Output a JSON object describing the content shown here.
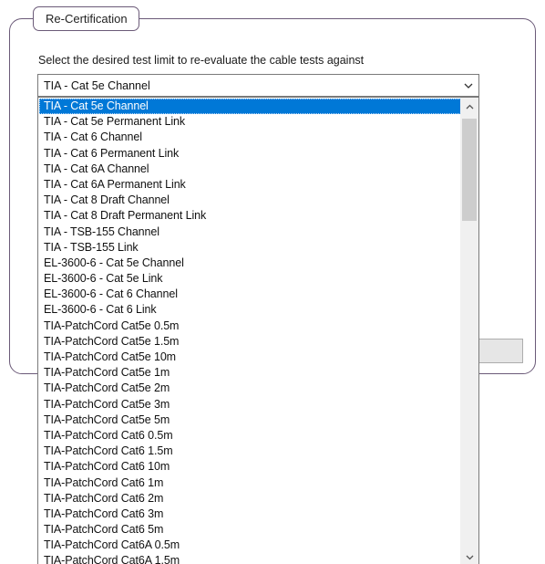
{
  "groupbox": {
    "title": "Re-Certification"
  },
  "instruction": "Select the desired test limit to re-evaluate the cable tests against",
  "combo": {
    "selected_value": "TIA - Cat 5e Channel"
  },
  "dropdown": {
    "scroll_position": 0.0,
    "items": [
      {
        "label": "TIA - Cat 5e Channel",
        "selected": true
      },
      {
        "label": "TIA - Cat 5e Permanent Link"
      },
      {
        "label": "TIA - Cat 6 Channel"
      },
      {
        "label": "TIA - Cat 6 Permanent Link"
      },
      {
        "label": "TIA - Cat 6A Channel"
      },
      {
        "label": "TIA - Cat 6A Permanent Link"
      },
      {
        "label": "TIA - Cat 8 Draft Channel"
      },
      {
        "label": "TIA - Cat 8 Draft Permanent Link"
      },
      {
        "label": "TIA - TSB-155 Channel"
      },
      {
        "label": "TIA - TSB-155 Link"
      },
      {
        "label": "EL-3600-6 - Cat 5e Channel"
      },
      {
        "label": "EL-3600-6 - Cat 5e Link"
      },
      {
        "label": "EL-3600-6 - Cat 6 Channel"
      },
      {
        "label": "EL-3600-6 - Cat 6 Link"
      },
      {
        "label": "TIA-PatchCord Cat5e 0.5m"
      },
      {
        "label": "TIA-PatchCord Cat5e 1.5m"
      },
      {
        "label": "TIA-PatchCord Cat5e 10m"
      },
      {
        "label": "TIA-PatchCord Cat5e 1m"
      },
      {
        "label": "TIA-PatchCord Cat5e 2m"
      },
      {
        "label": "TIA-PatchCord Cat5e 3m"
      },
      {
        "label": "TIA-PatchCord Cat5e 5m"
      },
      {
        "label": "TIA-PatchCord Cat6 0.5m"
      },
      {
        "label": "TIA-PatchCord Cat6 1.5m"
      },
      {
        "label": "TIA-PatchCord Cat6 10m"
      },
      {
        "label": "TIA-PatchCord Cat6 1m"
      },
      {
        "label": "TIA-PatchCord Cat6 2m"
      },
      {
        "label": "TIA-PatchCord Cat6 3m"
      },
      {
        "label": "TIA-PatchCord Cat6 5m"
      },
      {
        "label": "TIA-PatchCord Cat6A 0.5m"
      },
      {
        "label": "TIA-PatchCord Cat6A 1.5m"
      }
    ]
  },
  "icons": {
    "combo_arrow": "chevron-down-icon",
    "scroll_up": "chevron-up-icon",
    "scroll_down": "chevron-down-icon"
  },
  "colors": {
    "selection": "#0078d7",
    "groupbox_border": "#6b5a78",
    "scrollbar_track": "#f0f0f0",
    "scrollbar_thumb": "#cdcdcd"
  }
}
